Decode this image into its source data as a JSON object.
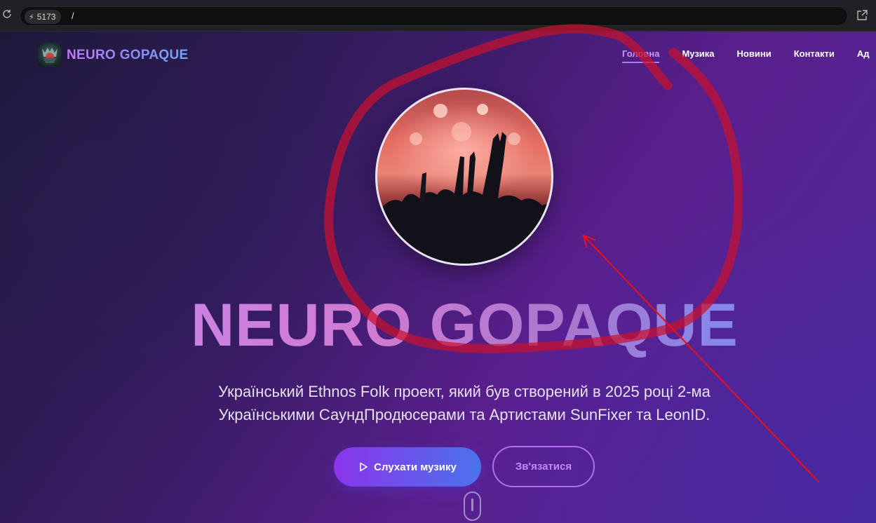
{
  "browser": {
    "port": "5173",
    "path": "/"
  },
  "site": {
    "logo_text": "NEURO GOPAQUE",
    "nav": [
      {
        "label": "Головна",
        "active": true
      },
      {
        "label": "Музика"
      },
      {
        "label": "Новини"
      },
      {
        "label": "Контакти"
      },
      {
        "label": "Ад"
      }
    ]
  },
  "hero": {
    "title": "NEURO GOPAQUE",
    "subtitle_line1": "Український Ethnos Folk проект, який був створений в 2025 році 2-ма",
    "subtitle_line2": "Українськими СаундПродюсерами та Артистами SunFixer та LeonID.",
    "primary_button": "Слухати музику",
    "secondary_button": "Зв'язатися"
  },
  "colors": {
    "annotation": "#c8102e",
    "accent_purple": "#8b35ec",
    "accent_blue": "#4a73ec"
  },
  "icons": [
    "reload-icon",
    "plug-icon",
    "external-link-icon",
    "play-icon",
    "scroll-mouse-icon"
  ]
}
